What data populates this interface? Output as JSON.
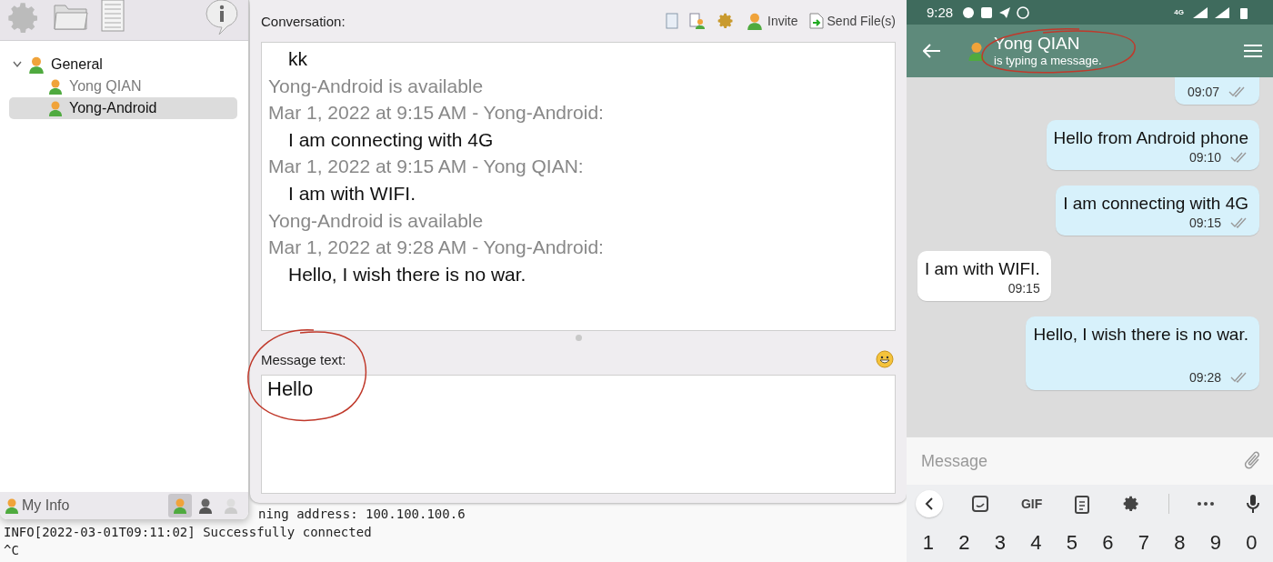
{
  "contacts_window": {
    "toolbar": [
      {
        "kind": "settings"
      },
      {
        "kind": "folder"
      },
      {
        "kind": "notes"
      },
      {
        "kind": "info"
      }
    ],
    "tree": [
      {
        "label": "General",
        "expanded": true,
        "children": [
          {
            "label": "Yong QIAN",
            "online": false,
            "selected": false
          },
          {
            "label": "Yong-Android",
            "online": true,
            "selected": true
          }
        ]
      }
    ],
    "status_bar": {
      "label": "My Info",
      "statuses": [
        {
          "kind": "online",
          "selected": true
        },
        {
          "kind": "away",
          "selected": false
        },
        {
          "kind": "offline",
          "selected": false
        }
      ]
    }
  },
  "conversation_window": {
    "title": "Conversation:",
    "toolbar": [
      {
        "kind": "log"
      },
      {
        "kind": "info"
      },
      {
        "kind": "settings"
      },
      {
        "kind": "invite",
        "label": "Invite"
      },
      {
        "kind": "send",
        "label": "Send File(s)"
      }
    ],
    "lines": [
      {
        "kind": "message",
        "text": "kk"
      },
      {
        "kind": "status",
        "text": "Yong-Android is available"
      },
      {
        "kind": "header",
        "text": "Mar 1, 2022 at 9:15 AM - Yong-Android:"
      },
      {
        "kind": "message",
        "text": "I am connecting with 4G"
      },
      {
        "kind": "header",
        "text": "Mar 1, 2022 at 9:15 AM - Yong QIAN:"
      },
      {
        "kind": "message",
        "text": "I am with WIFI."
      },
      {
        "kind": "status",
        "text": "Yong-Android is available"
      },
      {
        "kind": "header",
        "text": "Mar 1, 2022 at 9:28 AM - Yong-Android:"
      },
      {
        "kind": "message",
        "text": "Hello, I wish there is no war."
      }
    ],
    "input_label": "Message text:",
    "input_value": "Hello"
  },
  "terminal": {
    "lines": [
      "ning address: 100.100.100.6",
      "INFO[2022-03-01T09:11:02] Successfully connected",
      "^C"
    ]
  },
  "phone": {
    "time": "9:28",
    "network": "4G",
    "contact": "Yong QIAN",
    "subtitle": "is typing a message.",
    "messages": [
      {
        "kind": "sent",
        "time": "09:07"
      },
      {
        "kind": "sent",
        "text": "Hello from Android phone",
        "time": "09:10"
      },
      {
        "kind": "sent",
        "text": "I am connecting with 4G",
        "time": "09:15"
      },
      {
        "kind": "received",
        "text": "I am with WIFI.",
        "time": "09:15"
      },
      {
        "kind": "sent",
        "text": "Hello, I wish there is no war.",
        "time": "09:28"
      }
    ],
    "placeholder": "Message",
    "keyboard_toolbar": [
      {
        "kind": "back"
      },
      {
        "kind": "sticker"
      },
      {
        "kind": "gif",
        "label": "GIF"
      },
      {
        "kind": "clipboard"
      },
      {
        "kind": "settings"
      },
      {
        "kind": "divider"
      },
      {
        "kind": "more"
      },
      {
        "kind": "mic"
      }
    ],
    "number_keys": [
      "1",
      "2",
      "3",
      "4",
      "5",
      "6",
      "7",
      "8",
      "9",
      "0"
    ]
  }
}
